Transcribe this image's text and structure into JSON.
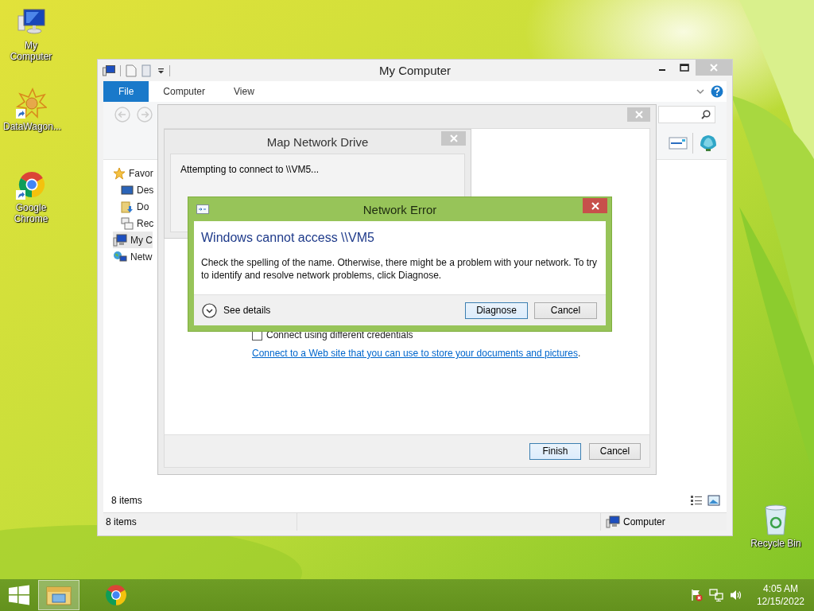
{
  "desktop_icons": [
    {
      "label": "My Computer",
      "kind": "computer",
      "shortcut": false
    },
    {
      "label": "DataWagon...",
      "kind": "star",
      "shortcut": true
    },
    {
      "label": "Google Chrome",
      "kind": "chrome",
      "shortcut": true
    },
    {
      "label": "Recycle Bin",
      "kind": "bin",
      "shortcut": false
    }
  ],
  "explorer": {
    "title": "My Computer",
    "ribbon_tabs": [
      {
        "label": "File",
        "kind": "file"
      },
      {
        "label": "Computer",
        "kind": "tab"
      },
      {
        "label": "View",
        "kind": "tab"
      }
    ],
    "nav_items": [
      {
        "label": "Favor",
        "kind": "star",
        "selected": false,
        "children": [
          {
            "label": "Des",
            "kind": "desktop",
            "selected": false
          },
          {
            "label": "Do",
            "kind": "downloads",
            "selected": false
          },
          {
            "label": "Rec",
            "kind": "recent",
            "selected": false
          }
        ]
      },
      {
        "label": "My C",
        "kind": "computer",
        "selected": true
      },
      {
        "label": "Netw",
        "kind": "network",
        "selected": false
      }
    ],
    "item_count": "8 items",
    "status_bar": {
      "items": "8 items",
      "location": "Computer"
    }
  },
  "wizard": {
    "credentials": {
      "label": "Connect using different credentials",
      "checked": false
    },
    "link": "Connect to a Web site that you can use to store your documents and pictures",
    "link_suffix": ".",
    "buttons": [
      {
        "label": "Finish",
        "default": true
      },
      {
        "label": "Cancel",
        "default": false
      }
    ]
  },
  "progress_dialog": {
    "title": "Map Network Drive",
    "message": "Attempting to connect to \\\\VM5..."
  },
  "error_dialog": {
    "title": "Network Error",
    "heading": "Windows cannot access \\\\VM5",
    "message": "Check the spelling of the name. Otherwise, there might be a problem with your network. To try to identify and resolve network problems, click Diagnose.",
    "details": "See details",
    "buttons": [
      {
        "label": "Diagnose",
        "default": true
      },
      {
        "label": "Cancel",
        "default": false
      }
    ]
  },
  "taskbar": {
    "apps": [
      {
        "kind": "explorer",
        "active": true
      },
      {
        "kind": "chrome",
        "active": false
      }
    ],
    "time": "4:05 AM",
    "date": "12/15/2022"
  }
}
